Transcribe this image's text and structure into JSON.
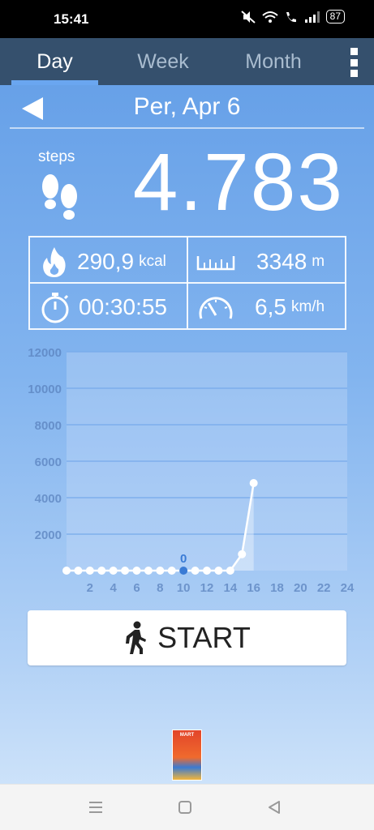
{
  "status_bar": {
    "time": "15:41",
    "battery": "87",
    "icons": [
      "mute-icon",
      "wifi-icon",
      "wifi-call-icon",
      "signal-icon",
      "battery-icon"
    ]
  },
  "tabs": [
    {
      "label": "Day",
      "active": true
    },
    {
      "label": "Week",
      "active": false
    },
    {
      "label": "Month",
      "active": false
    }
  ],
  "date_title": "Per, Apr 6",
  "steps": {
    "label": "steps",
    "value": "4.783"
  },
  "stats": {
    "calories": {
      "value": "290,9",
      "unit": "kcal",
      "icon": "flame-icon"
    },
    "distance": {
      "value": "3348",
      "unit": "m",
      "icon": "ruler-icon"
    },
    "duration": {
      "value": "00:30:55",
      "icon": "stopwatch-icon"
    },
    "speed": {
      "value": "6,5",
      "unit": "km/h",
      "icon": "speedometer-icon"
    }
  },
  "chart_data": {
    "type": "line",
    "x": [
      0,
      1,
      2,
      3,
      4,
      5,
      6,
      7,
      8,
      9,
      10,
      11,
      12,
      13,
      14,
      15,
      16
    ],
    "values": [
      0,
      0,
      0,
      0,
      0,
      0,
      0,
      0,
      0,
      0,
      0,
      0,
      0,
      0,
      0,
      900,
      4800
    ],
    "xticks": [
      "2",
      "4",
      "6",
      "8",
      "10",
      "12",
      "14",
      "16",
      "18",
      "20",
      "22",
      "24"
    ],
    "yticks": [
      "2000",
      "4000",
      "6000",
      "8000",
      "10000",
      "12000"
    ],
    "xlim": [
      0,
      24
    ],
    "ylim": [
      0,
      12000
    ],
    "selected_label": "0",
    "selected_index": 10,
    "grid": true
  },
  "start_button": {
    "label": "START"
  },
  "ad": {
    "text": "MART"
  },
  "colors": {
    "tab_bar": "#35506d",
    "tab_indicator": "#6aa6f0",
    "chart_line": "#ffffff",
    "selected_point": "#3a7bd5"
  }
}
